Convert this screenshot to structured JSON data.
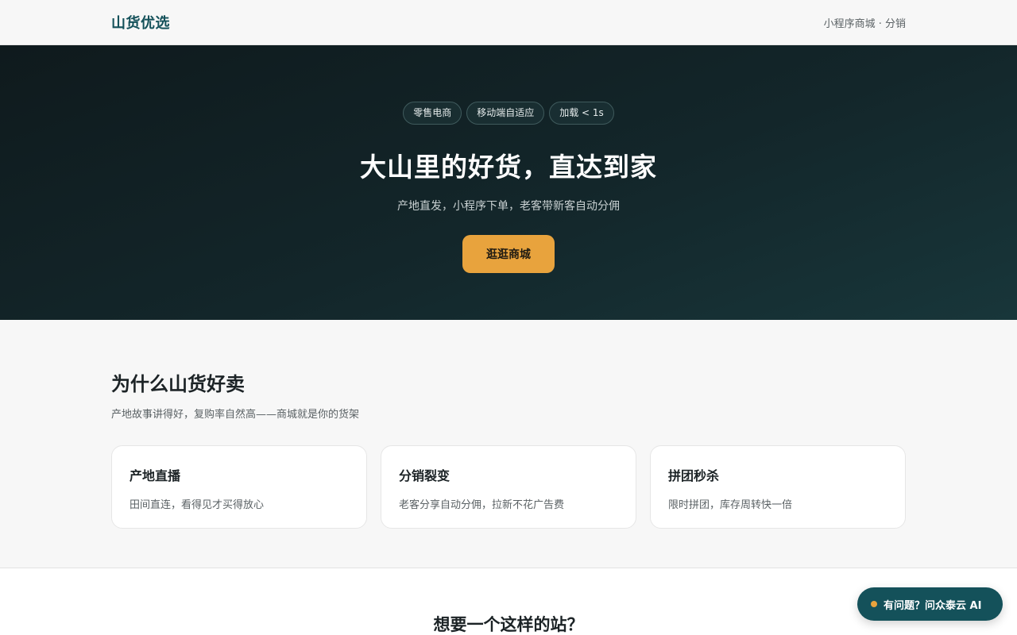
{
  "header": {
    "brand": "山货优选",
    "tagline": "小程序商城 · 分销"
  },
  "hero": {
    "tags": [
      "零售电商",
      "移动端自适应",
      "加载 < 1s"
    ],
    "title": "大山里的好货，直达到家",
    "subtitle": "产地直发，小程序下单，老客带新客自动分佣",
    "cta_label": "逛逛商城"
  },
  "features": {
    "title": "为什么山货好卖",
    "subtitle": "产地故事讲得好，复购率自然高——商城就是你的货架",
    "cards": [
      {
        "title": "产地直播",
        "desc": "田间直连，看得见才买得放心"
      },
      {
        "title": "分销裂变",
        "desc": "老客分享自动分佣，拉新不花广告费"
      },
      {
        "title": "拼团秒杀",
        "desc": "限时拼团，库存周转快一倍"
      }
    ]
  },
  "cta_section": {
    "title": "想要一个这样的站？"
  },
  "chat": {
    "label": "有问题？问众泰云 AI"
  },
  "colors": {
    "brand": "#14515a",
    "accent": "#e8a33d",
    "hero_bg": "#0f1a1d"
  }
}
